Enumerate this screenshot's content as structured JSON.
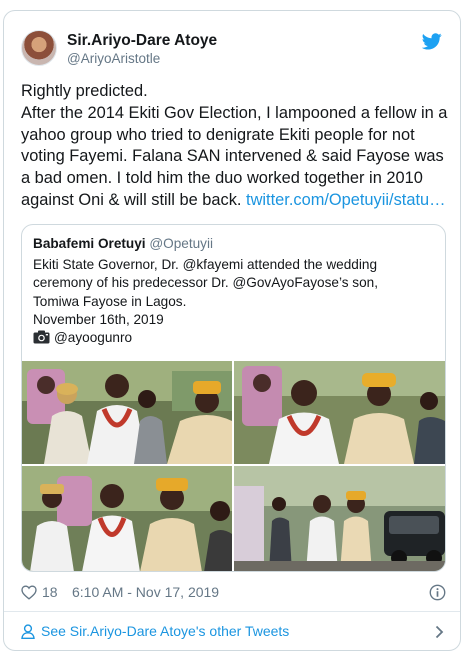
{
  "author": {
    "display_name": "Sir.Ariyo-Dare Atoye",
    "handle": "@AriyoAristotle"
  },
  "tweet": {
    "line1": "Rightly predicted.",
    "body": "After the 2014 Ekiti Gov Election, I lampooned a fellow in a yahoo group who tried to denigrate Ekiti people for not voting Fayemi. Falana SAN intervened & said Fayose was a bad omen. I told him the duo worked together in 2010 against Oni & will still be back. ",
    "link": "twitter.com/Opetuyii/statu…"
  },
  "quoted": {
    "display_name": "Babafemi Oretuyi",
    "handle": "@Opetuyii",
    "lines": [
      "Ekiti State Governor, Dr. @kfayemi attended the wedding",
      "ceremony of his predecessor Dr. @GovAyoFayose’s son,",
      "Tomiwa Fayose in Lagos.",
      "November 16th, 2019"
    ],
    "credit": "@ayoogunro"
  },
  "footer": {
    "likes": "18",
    "timestamp": "6:10 AM - Nov 17, 2019",
    "see_more": "See Sir.Ariyo-Dare Atoye's other Tweets"
  },
  "colors": {
    "twitter_blue": "#1da1f2",
    "link": "#1b95e0",
    "secondary_text": "#657786",
    "border": "#cfd9de"
  },
  "icons": [
    "twitter-bird-icon",
    "camera-icon",
    "heart-icon",
    "info-icon",
    "person-icon",
    "chevron-right-icon"
  ]
}
